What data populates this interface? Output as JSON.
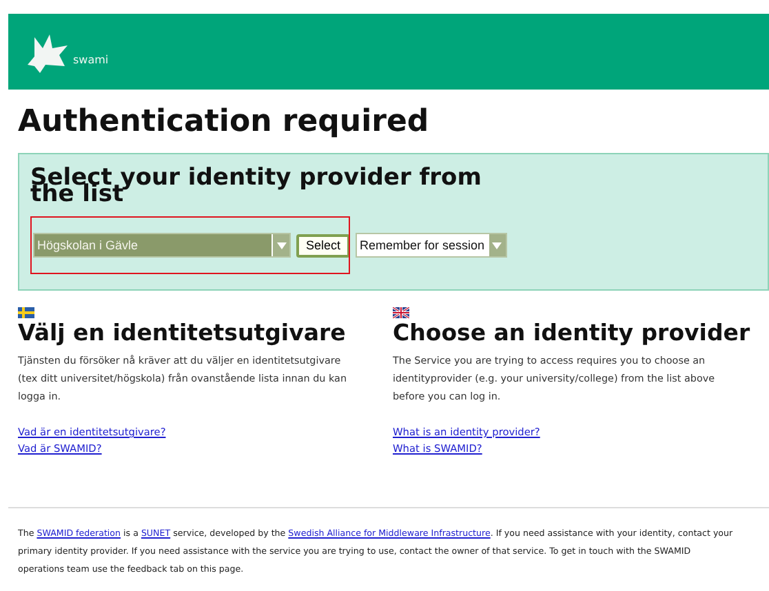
{
  "header": {
    "logo_text": "swami"
  },
  "title": "Authentication required",
  "selector": {
    "heading": "Select your identity provider from the list",
    "provider": "Högskolan i Gävle",
    "button": "Select",
    "remember": "Remember for session"
  },
  "columns": [
    {
      "kind": "sweden",
      "heading": "Välj en identitetsutgivare",
      "body": "Tjänsten du försöker nå kräver att du väljer en identitetsutgivare (tex ditt universitet/högskola) från ovanstående lista innan du kan logga in.",
      "links": [
        "Vad är en identitetsutgivare?",
        "Vad är SWAMID?"
      ]
    },
    {
      "kind": "uk",
      "heading": "Choose an identity provider",
      "body": "The Service you are trying to access requires you to choose an identityprovider (e.g. your university/college) from the list above before you can log in.",
      "links": [
        "What is an identity provider?",
        "What is SWAMID?"
      ]
    }
  ],
  "footer": [
    {
      "kind": "text",
      "text": "The "
    },
    {
      "kind": "link",
      "text": "SWAMID federation"
    },
    {
      "kind": "text",
      "text": " is a "
    },
    {
      "kind": "link",
      "text": "SUNET"
    },
    {
      "kind": "text",
      "text": " service, developed by the "
    },
    {
      "kind": "link",
      "text": "Swedish Alliance for Middleware Infrastructure"
    },
    {
      "kind": "text",
      "text": ". If you need assistance with your identity, contact your primary identity provider. If you need assistance with the service you are trying to use, contact the owner of that service. To get in touch with the SWAMID operations team use the feedback tab on this page."
    }
  ]
}
